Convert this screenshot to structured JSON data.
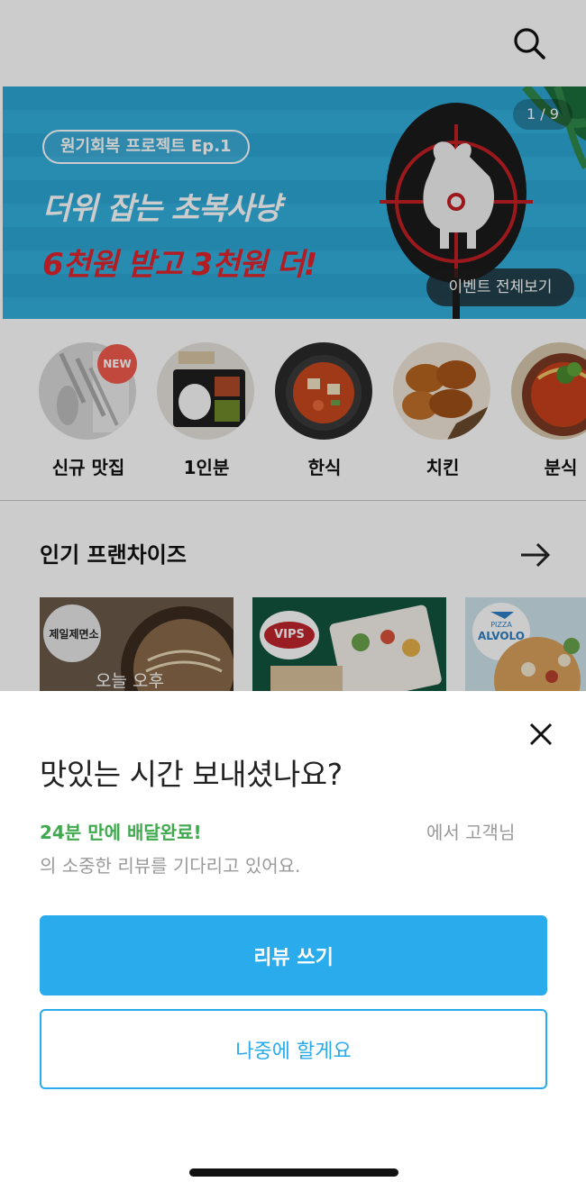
{
  "header": {
    "search_icon": "search-icon"
  },
  "banner": {
    "pill": "원기회복 프로젝트 Ep.1",
    "title": "더위 잡는 초복사냥",
    "subtitle": "6천원 받고 3천원 더!",
    "counter": "1 / 9",
    "view_all": "이벤트 전체보기",
    "colors": {
      "background": "#2ea7d6",
      "subtitle": "#e0242c"
    }
  },
  "categories": [
    {
      "label": "신규 맛집",
      "badge": "NEW"
    },
    {
      "label": "1인분"
    },
    {
      "label": "한식"
    },
    {
      "label": "치킨"
    },
    {
      "label": "분식"
    }
  ],
  "popular": {
    "title": "인기 프랜차이즈",
    "arrow_icon": "arrow-right-icon",
    "franchises": [
      {
        "logo": "제일제면소",
        "caption": "오늘 오후"
      },
      {
        "logo": "VIPS"
      },
      {
        "logo": "ALVOLO",
        "logo_top": "PIZZA"
      }
    ]
  },
  "review_sheet": {
    "title": "맛있는 시간 보내셨나요?",
    "delivery_time": "24분 만에 배달완료!",
    "from_text": "에서 고객님",
    "body": "의 소중한 리뷰를 기다리고 있어요.",
    "primary_button": "리뷰 쓰기",
    "secondary_button": "나중에 할게요",
    "close_icon": "close-icon",
    "colors": {
      "accent": "#2aabeb",
      "success": "#3fa94d"
    }
  }
}
